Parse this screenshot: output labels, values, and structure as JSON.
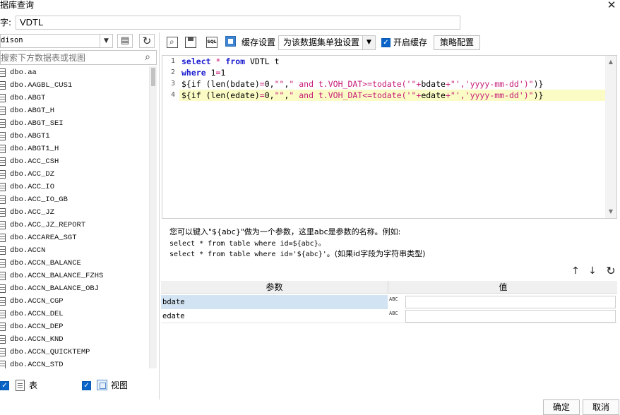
{
  "window": {
    "title": "据库查询",
    "close_glyph": "✕"
  },
  "name_field": {
    "label": "字:",
    "value": "VDTL"
  },
  "left_panel": {
    "connection": "dison",
    "search_placeholder": "搜索下方数据表或视图",
    "tables": [
      "dbo.aa",
      "dbo.AAGBL_CUS1",
      "dbo.ABGT",
      "dbo.ABGT_H",
      "dbo.ABGT_SEI",
      "dbo.ABGT1",
      "dbo.ABGT1_H",
      "dbo.ACC_CSH",
      "dbo.ACC_DZ",
      "dbo.ACC_IO",
      "dbo.ACC_IO_GB",
      "dbo.ACC_JZ",
      "dbo.ACC_JZ_REPORT",
      "dbo.ACCAREA_SGT",
      "dbo.ACCN",
      "dbo.ACCN_BALANCE",
      "dbo.ACCN_BALANCE_FZHS",
      "dbo.ACCN_BALANCE_OBJ",
      "dbo.ACCN_CGP",
      "dbo.ACCN_DEL",
      "dbo.ACCN_DEP",
      "dbo.ACCN_KND",
      "dbo.ACCN_QUICKTEMP",
      "dbo.ACCN_STD"
    ],
    "filter_table_label": "表",
    "filter_view_label": "视图"
  },
  "toolbar": {
    "cache_label": "缓存设置",
    "cache_mode": "为该数据集单独设置",
    "enable_cache_label": "开启缓存",
    "strategy_label": "策略配置",
    "sql_icon_text": "SQL"
  },
  "editor": {
    "line_numbers": [
      "1",
      "2",
      "3",
      "4"
    ],
    "lines": [
      "select * from VDTL t",
      "where 1=1",
      "${if (len(bdate)=0,\"\",\" and t.VOH_DAT>=todate('\"+bdate+\"','yyyy-mm-dd')\")}",
      "${if (len(edate)=0,\"\",\" and t.VOH_DAT<=todate('\"+edate+\"','yyyy-mm-dd')\")}"
    ]
  },
  "hint": {
    "line1": "您可以键入\"${abc}\"做为一个参数，这里abc是参数的名称。例如:",
    "line2": "select * from table where id=${abc}。",
    "line3_code": "select * from table where id='${abc}'",
    "line3_note": "。(如果id字段为字符串类型)"
  },
  "params": {
    "header_name": "参数",
    "header_value": "值",
    "rows": [
      {
        "name": "bdate",
        "value": ""
      },
      {
        "name": "edate",
        "value": ""
      }
    ],
    "type_badge": "ABC"
  },
  "dialog_buttons": {
    "ok": "确定",
    "cancel": "取消"
  }
}
